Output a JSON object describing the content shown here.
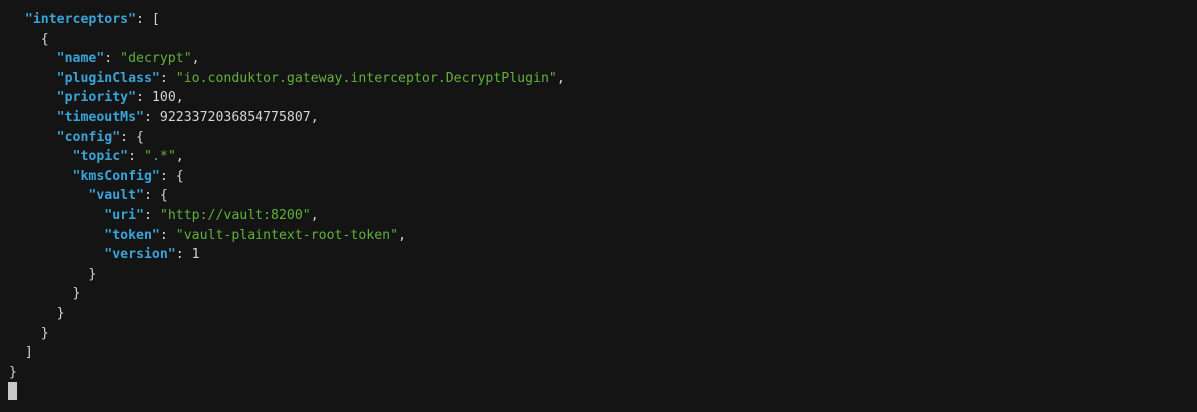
{
  "terminal": {
    "lines": [
      [
        {
          "t": "  ",
          "c": "punct"
        },
        {
          "t": "\"interceptors\"",
          "c": "key"
        },
        {
          "t": ": [",
          "c": "punct"
        }
      ],
      [
        {
          "t": "    {",
          "c": "punct"
        }
      ],
      [
        {
          "t": "      ",
          "c": "punct"
        },
        {
          "t": "\"name\"",
          "c": "key"
        },
        {
          "t": ": ",
          "c": "punct"
        },
        {
          "t": "\"decrypt\"",
          "c": "str"
        },
        {
          "t": ",",
          "c": "punct"
        }
      ],
      [
        {
          "t": "      ",
          "c": "punct"
        },
        {
          "t": "\"pluginClass\"",
          "c": "key"
        },
        {
          "t": ": ",
          "c": "punct"
        },
        {
          "t": "\"io.conduktor.gateway.interceptor.DecryptPlugin\"",
          "c": "str"
        },
        {
          "t": ",",
          "c": "punct"
        }
      ],
      [
        {
          "t": "      ",
          "c": "punct"
        },
        {
          "t": "\"priority\"",
          "c": "key"
        },
        {
          "t": ": ",
          "c": "punct"
        },
        {
          "t": "100",
          "c": "num"
        },
        {
          "t": ",",
          "c": "punct"
        }
      ],
      [
        {
          "t": "      ",
          "c": "punct"
        },
        {
          "t": "\"timeoutMs\"",
          "c": "key"
        },
        {
          "t": ": ",
          "c": "punct"
        },
        {
          "t": "9223372036854775807",
          "c": "num"
        },
        {
          "t": ",",
          "c": "punct"
        }
      ],
      [
        {
          "t": "      ",
          "c": "punct"
        },
        {
          "t": "\"config\"",
          "c": "key"
        },
        {
          "t": ": {",
          "c": "punct"
        }
      ],
      [
        {
          "t": "        ",
          "c": "punct"
        },
        {
          "t": "\"topic\"",
          "c": "key"
        },
        {
          "t": ": ",
          "c": "punct"
        },
        {
          "t": "\".*\"",
          "c": "str"
        },
        {
          "t": ",",
          "c": "punct"
        }
      ],
      [
        {
          "t": "        ",
          "c": "punct"
        },
        {
          "t": "\"kmsConfig\"",
          "c": "key"
        },
        {
          "t": ": {",
          "c": "punct"
        }
      ],
      [
        {
          "t": "          ",
          "c": "punct"
        },
        {
          "t": "\"vault\"",
          "c": "key"
        },
        {
          "t": ": {",
          "c": "punct"
        }
      ],
      [
        {
          "t": "            ",
          "c": "punct"
        },
        {
          "t": "\"uri\"",
          "c": "key"
        },
        {
          "t": ": ",
          "c": "punct"
        },
        {
          "t": "\"http://vault:8200\"",
          "c": "str"
        },
        {
          "t": ",",
          "c": "punct"
        }
      ],
      [
        {
          "t": "            ",
          "c": "punct"
        },
        {
          "t": "\"token\"",
          "c": "key"
        },
        {
          "t": ": ",
          "c": "punct"
        },
        {
          "t": "\"vault-plaintext-root-token\"",
          "c": "str"
        },
        {
          "t": ",",
          "c": "punct"
        }
      ],
      [
        {
          "t": "            ",
          "c": "punct"
        },
        {
          "t": "\"version\"",
          "c": "key"
        },
        {
          "t": ": ",
          "c": "punct"
        },
        {
          "t": "1",
          "c": "num"
        }
      ],
      [
        {
          "t": "          }",
          "c": "punct"
        }
      ],
      [
        {
          "t": "        }",
          "c": "punct"
        }
      ],
      [
        {
          "t": "      }",
          "c": "punct"
        }
      ],
      [
        {
          "t": "    }",
          "c": "punct"
        }
      ],
      [
        {
          "t": "  ]",
          "c": "punct"
        }
      ],
      [
        {
          "t": "}",
          "c": "punct"
        }
      ]
    ]
  },
  "colors": {
    "background": "#141415",
    "key": "#3aa3d8",
    "string": "#5fb13a",
    "text": "#d4d4d4",
    "cursor": "#c8c8c8"
  }
}
